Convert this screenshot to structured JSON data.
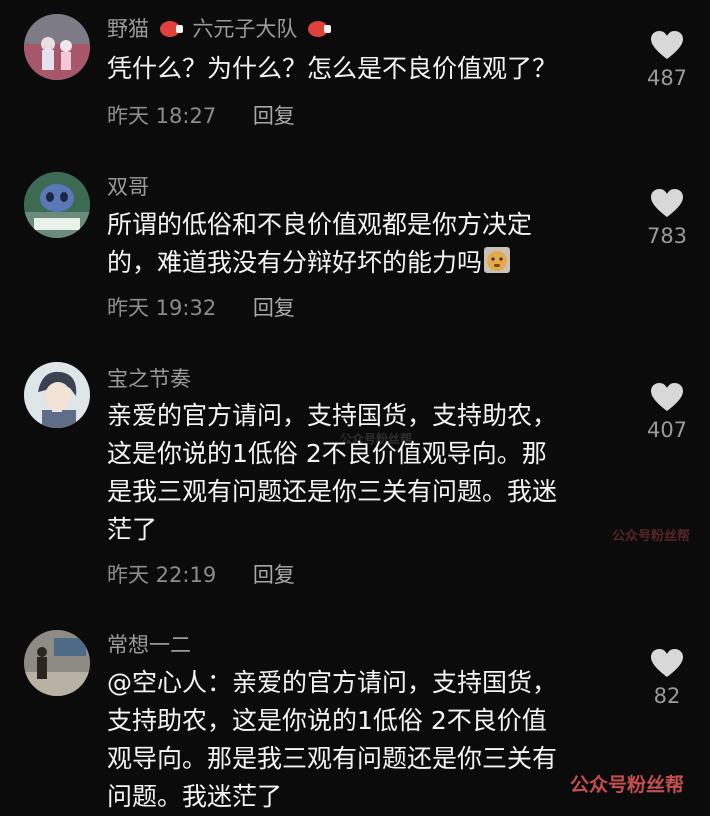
{
  "comments": [
    {
      "username": "野猫",
      "name_suffix": "六元子大队",
      "lines": [
        "凭什么？为什么？怎么是不良价值观了？"
      ],
      "time": "昨天 18:27",
      "reply_label": "回复",
      "likes": "487",
      "avatar_icon": "avatar-photo-icon"
    },
    {
      "username": "双哥",
      "lines": [
        "所谓的低俗和不良价值观都是你方决定",
        "的，难道我没有分辩好坏的能力吗"
      ],
      "time": "昨天 19:32",
      "reply_label": "回复",
      "likes": "783",
      "avatar_icon": "stitch-avatar-icon"
    },
    {
      "username": "宝之节奏",
      "lines": [
        "亲爱的官方请问，支持国货，支持助农，",
        "这是你说的1低俗 2不良价值观导向。那",
        "是我三观有问题还是你三关有问题。我迷",
        "茫了"
      ],
      "time": "昨天 22:19",
      "reply_label": "回复",
      "likes": "407",
      "avatar_icon": "anime-avatar-icon"
    },
    {
      "username": "常想一二",
      "lines": [
        "@空心人：亲爱的官方请问，支持国货，",
        "支持助农，这是你说的1低俗 2不良价值",
        "观导向。那是我三观有问题还是你三关有",
        "问题。我迷茫了"
      ],
      "likes": "82",
      "avatar_icon": "person-avatar-icon"
    }
  ],
  "watermark": "公众号粉丝帮",
  "colors": {
    "background": "#0b0b0b",
    "text": "#f4f4f4",
    "secondary": "#9a9a9a",
    "heart": "#d8d8d8"
  }
}
